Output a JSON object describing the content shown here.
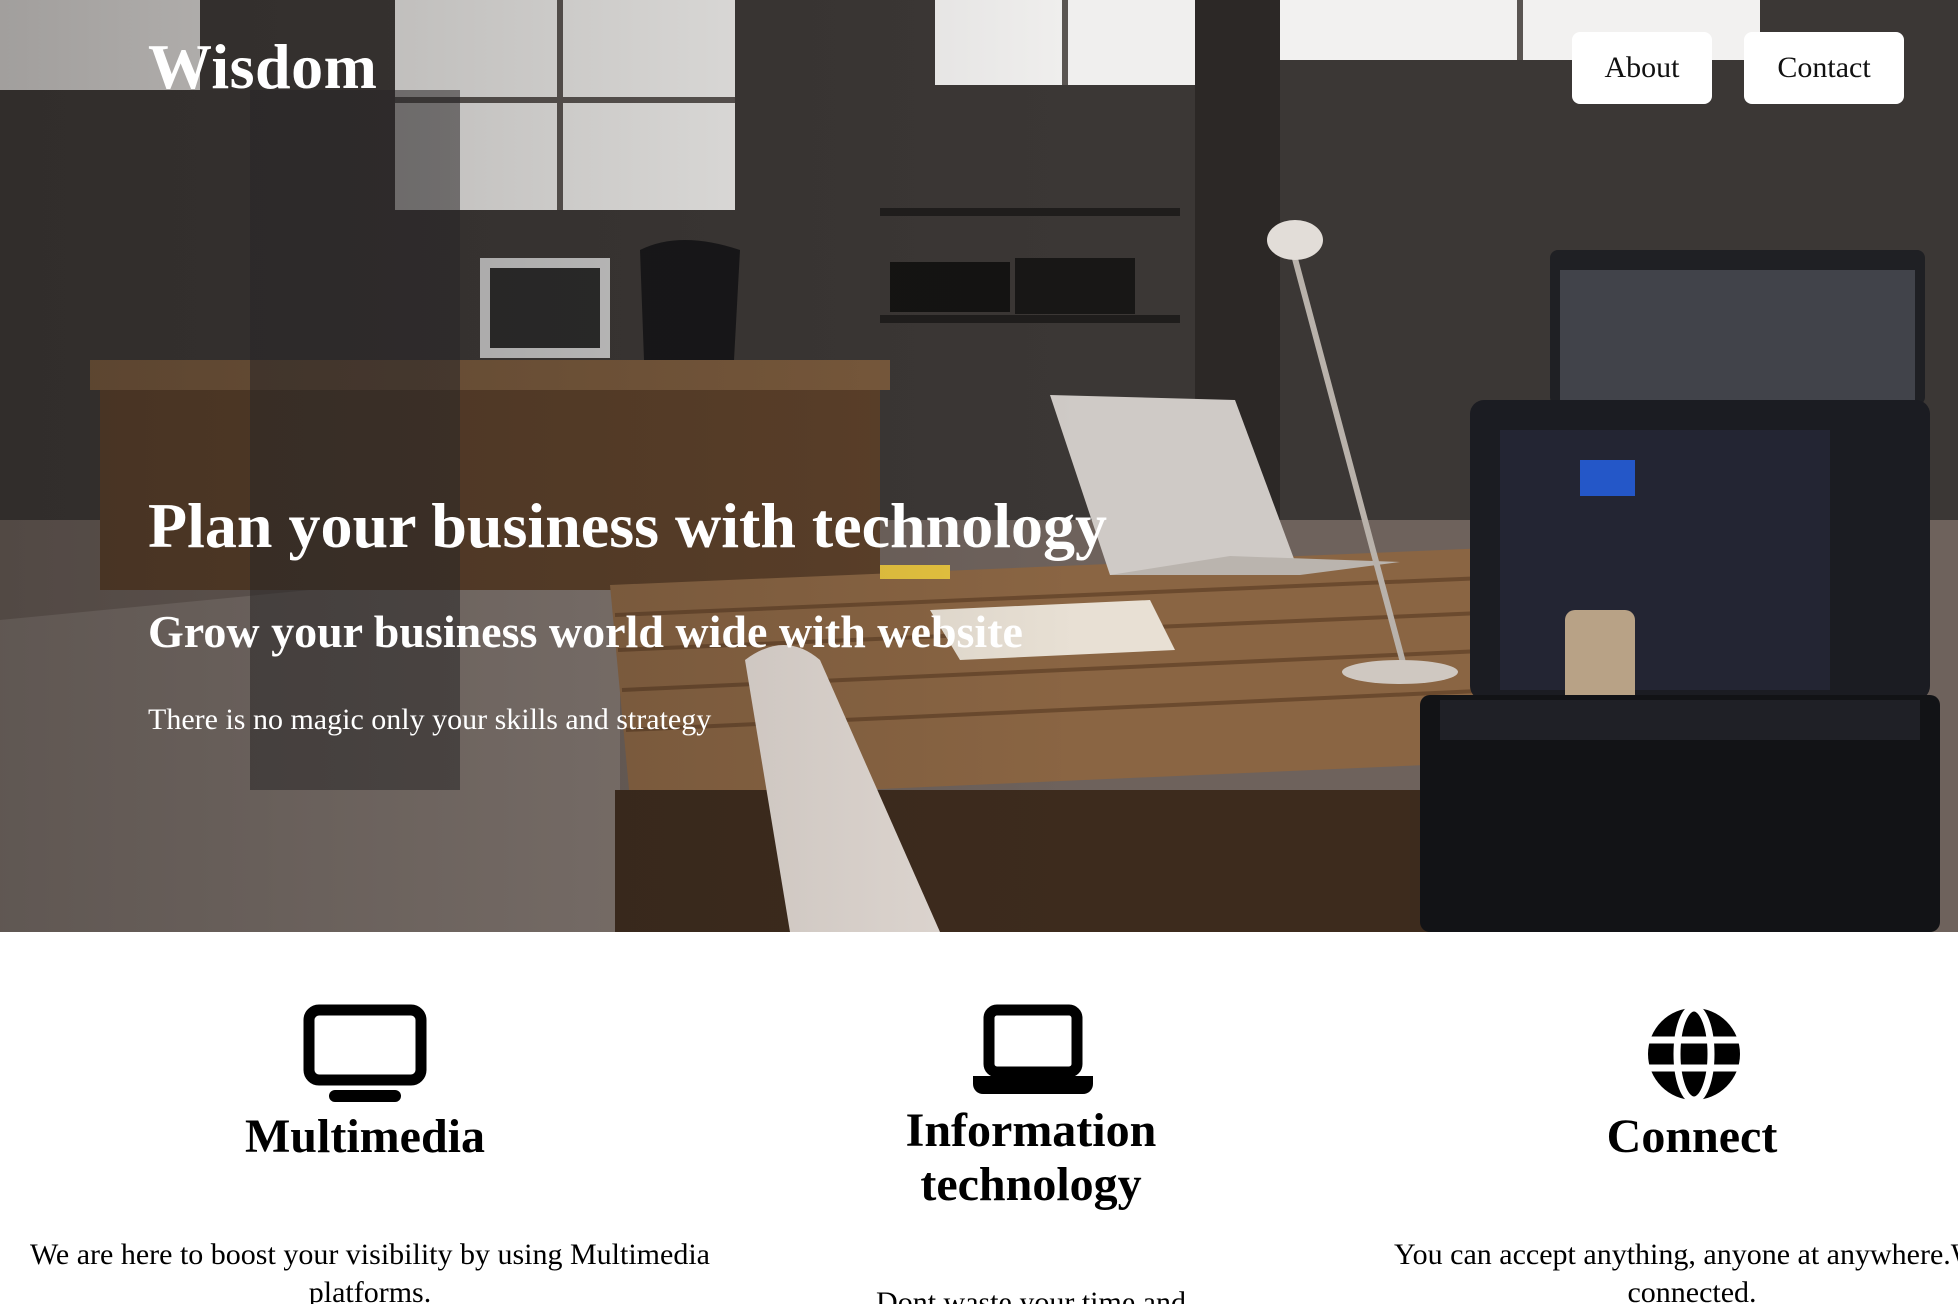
{
  "header": {
    "logo": "Wisdom",
    "nav": {
      "about": "About",
      "contact": "Contact"
    }
  },
  "hero": {
    "title": "Plan your business with technology",
    "subtitle": "Grow your business world wide with website",
    "text": "There is no magic only your skills and strategy"
  },
  "features": [
    {
      "icon": "monitor-icon",
      "title": "Multimedia",
      "text": "We are here to boost your visibility by using Multimedia platforms."
    },
    {
      "icon": "laptop-icon",
      "title": "Information technology",
      "text": "Dont waste your time and resources."
    },
    {
      "icon": "globe-icon",
      "title": "Connect",
      "text": "You can accept anything, anyone at anywhere.We connected."
    }
  ]
}
